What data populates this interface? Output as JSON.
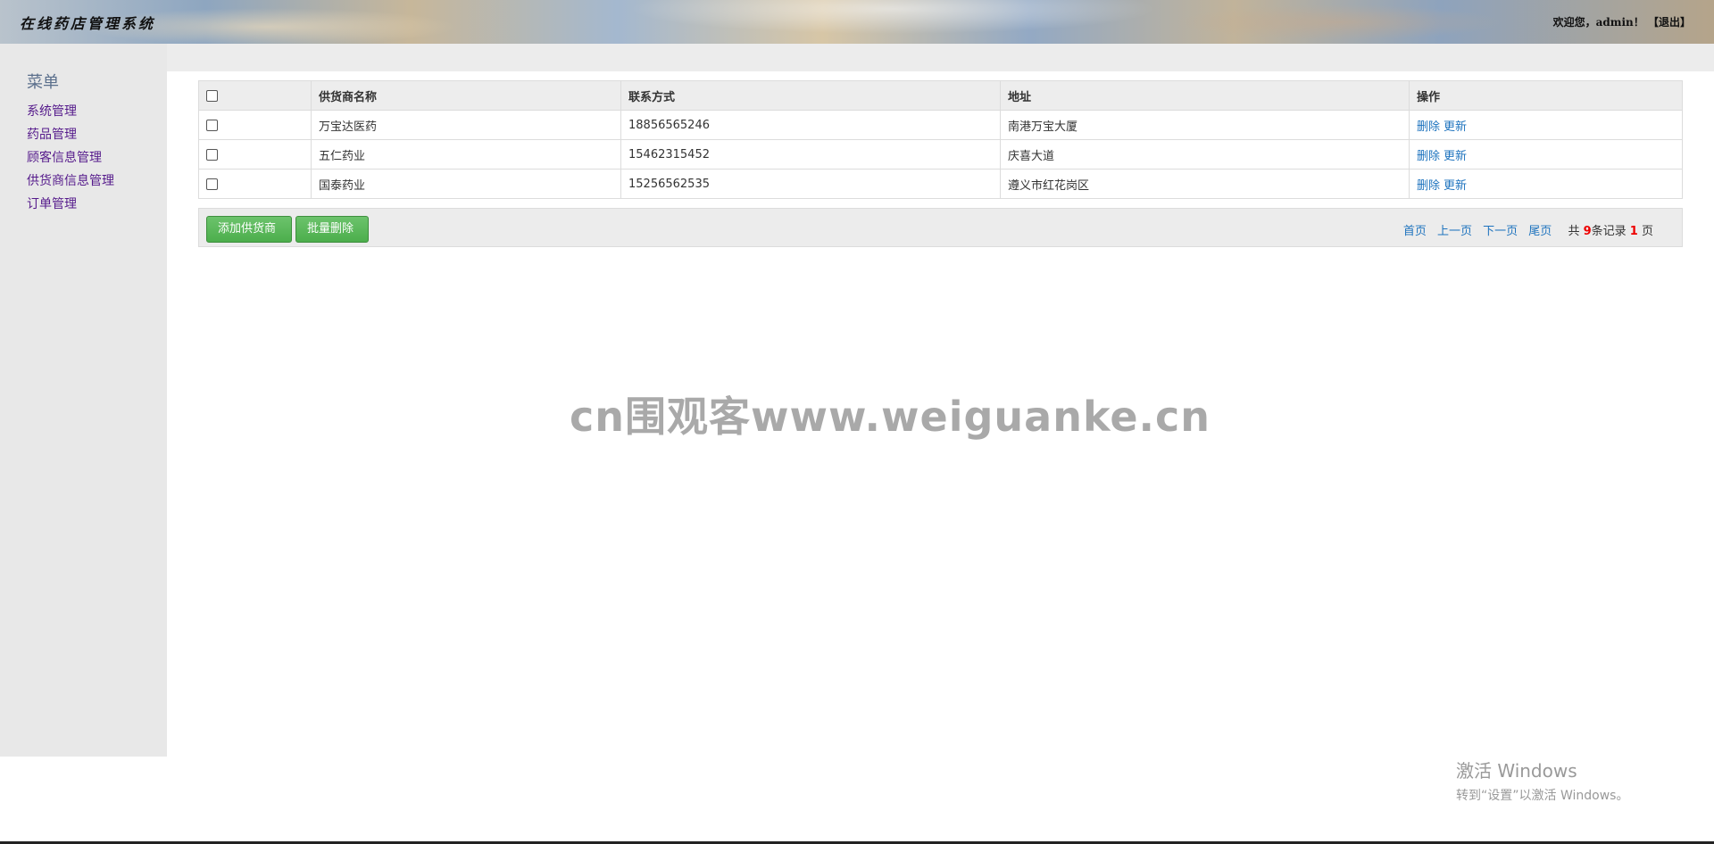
{
  "header": {
    "title": "在线药店管理系统",
    "welcome_prefix": "欢迎您，",
    "username": "admin",
    "welcome_suffix": "！",
    "logout_label": "【退出】"
  },
  "sidebar": {
    "menu_title": "菜单",
    "items": [
      {
        "label": "系统管理"
      },
      {
        "label": "药品管理"
      },
      {
        "label": "顾客信息管理"
      },
      {
        "label": "供货商信息管理"
      },
      {
        "label": "订单管理"
      }
    ]
  },
  "table": {
    "headers": [
      "",
      "供货商名称",
      "联系方式",
      "地址",
      "操作"
    ],
    "rows": [
      {
        "name": "万宝达医药",
        "phone": "18856565246",
        "address": "南港万宝大厦",
        "delete": "删除",
        "update": "更新"
      },
      {
        "name": "五仁药业",
        "phone": "15462315452",
        "address": "庆喜大道",
        "delete": "删除",
        "update": "更新"
      },
      {
        "name": "国泰药业",
        "phone": "15256562535",
        "address": "遵义市红花岗区",
        "delete": "删除",
        "update": "更新"
      }
    ]
  },
  "actions": {
    "add_label": "添加供货商",
    "batch_delete_label": "批量删除"
  },
  "pager": {
    "first": "首页",
    "prev": "上一页",
    "next": "下一页",
    "last": "尾页",
    "total_prefix": "共",
    "total_records": "9",
    "records_suffix": "条记录",
    "total_pages": "1",
    "pages_suffix": "页"
  },
  "watermark": "cn围观客www.weiguanke.cn",
  "windows_activation": {
    "title": "激活 Windows",
    "subtitle": "转到“设置”以激活 Windows。"
  },
  "colors": {
    "link": "#1e73be",
    "button_green": "#4cae4c",
    "sidebar_bg": "#e8e8e8",
    "menu_link": "#551a8b",
    "pager_count": "#ee0000"
  }
}
